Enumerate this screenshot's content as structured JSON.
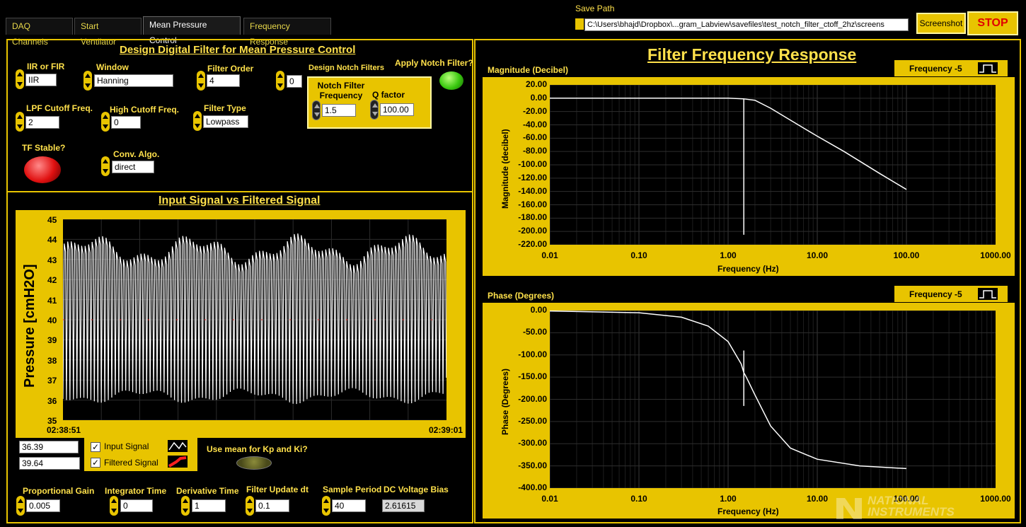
{
  "tabs": [
    {
      "label": "DAQ Channels",
      "active": false
    },
    {
      "label": "Start Ventilator",
      "active": false
    },
    {
      "label": "Mean Pressure Control",
      "active": true
    },
    {
      "label": "Frequency Response",
      "active": false
    }
  ],
  "save_path": {
    "label": "Save Path",
    "value": "C:\\Users\\bhajd\\Dropbox\\...gram_Labview\\savefiles\\test_notch_filter_ctoff_2hz\\screens"
  },
  "buttons": {
    "screenshot": "Screenshot",
    "stop": "STOP"
  },
  "design": {
    "title": "Design Digital Filter for Mean Pressure Control",
    "iir_fir": {
      "label": "IIR or FIR",
      "value": "IIR"
    },
    "window": {
      "label": "Window",
      "value": "Hanning"
    },
    "filter_order": {
      "label": "Filter Order",
      "value": "4"
    },
    "notch_count": {
      "value": "0"
    },
    "design_notch_label": "Design Notch Filters",
    "apply_notch": {
      "label": "Apply Notch Filter?",
      "on": true
    },
    "notch_freq": {
      "label": "Notch Filter Frequency",
      "value": "1.5"
    },
    "q_factor": {
      "label": "Q factor",
      "value": "100.00"
    },
    "lpf_cutoff": {
      "label": "LPF Cutoff  Freq.",
      "value": "2"
    },
    "high_cutoff": {
      "label": "High Cutoff Freq.",
      "value": "0"
    },
    "filter_type": {
      "label": "Filter Type",
      "value": "Lowpass"
    },
    "tf_stable": {
      "label": "TF Stable?",
      "on": false
    },
    "conv_algo": {
      "label": "Conv. Algo.",
      "value": "direct"
    }
  },
  "signal_chart": {
    "title": "Input Signal vs Filtered Signal",
    "ylabel": "Pressure [cmH2O]",
    "y_ticks": [
      "45",
      "44",
      "43",
      "42",
      "41",
      "40",
      "39",
      "38",
      "37",
      "36",
      "35"
    ],
    "x_start": "02:38:51",
    "x_end": "02:39:01",
    "readout_1": "36.39",
    "readout_2": "39.64",
    "legend": [
      {
        "label": "Input Signal",
        "checked": true,
        "color": "#ffffff"
      },
      {
        "label": "Filtered Signal",
        "checked": true,
        "color": "#ff2020"
      }
    ],
    "use_mean_label": "Use mean for Kp and Ki?"
  },
  "chart_data": [
    {
      "type": "line",
      "title": "Input Signal vs Filtered Signal",
      "ylabel": "Pressure [cmH2O]",
      "xlabel": "",
      "x_range": [
        "02:38:51",
        "02:39:01"
      ],
      "ylim": [
        35,
        45
      ],
      "grid": true,
      "series": [
        {
          "name": "Input Signal",
          "color": "#ffffff",
          "min": 35.9,
          "max": 44.0,
          "approx_cycles": 110
        },
        {
          "name": "Filtered Signal",
          "color": "#ff2020",
          "mean": 40.0
        }
      ]
    },
    {
      "type": "line",
      "title": "Magnitude (Decibel)",
      "xlabel": "Frequency (Hz)",
      "ylabel": "Magnitude (decibel)",
      "xscale": "log",
      "xlim": [
        0.01,
        1000
      ],
      "ylim": [
        -220,
        20
      ],
      "grid": true,
      "x": [
        0.01,
        0.1,
        1.0,
        1.5,
        1.5,
        1.5,
        2.0,
        3.0,
        5.0,
        10.0,
        20.0,
        50.0,
        100.0
      ],
      "y": [
        0,
        0,
        0,
        -1,
        -205,
        -1,
        -3,
        -15,
        -33,
        -57,
        -80,
        -113,
        -137
      ]
    },
    {
      "type": "line",
      "title": "Phase (Degrees)",
      "xlabel": "Frequency (Hz)",
      "ylabel": "Phase (Degrees)",
      "xscale": "log",
      "xlim": [
        0.01,
        1000
      ],
      "ylim": [
        -400,
        0
      ],
      "grid": true,
      "x": [
        0.01,
        0.1,
        0.3,
        0.6,
        1.0,
        1.4,
        1.5,
        1.5,
        1.5,
        1.5,
        1.6,
        2.0,
        3.0,
        5.0,
        10.0,
        30.0,
        100.0
      ],
      "y": [
        -1,
        -5,
        -15,
        -35,
        -70,
        -120,
        -140,
        -90,
        -215,
        -140,
        -150,
        -190,
        -260,
        -310,
        -335,
        -350,
        -356
      ]
    }
  ],
  "freq_response": {
    "title": "Filter Frequency Response",
    "magnitude": {
      "title": "Magnitude (Decibel)",
      "legend": "Frequency -5",
      "ylabel": "Magnitude (decibel)",
      "xlabel": "Frequency (Hz)",
      "y_ticks": [
        "20.00",
        "0.00",
        "-20.00",
        "-40.00",
        "-60.00",
        "-80.00",
        "-100.00",
        "-120.00",
        "-140.00",
        "-160.00",
        "-180.00",
        "-200.00",
        "-220.00"
      ],
      "x_ticks": [
        "0.01",
        "0.10",
        "1.00",
        "10.00",
        "100.00",
        "1000.00"
      ]
    },
    "phase": {
      "title": "Phase (Degrees)",
      "legend": "Frequency -5",
      "ylabel": "Phase (Degrees)",
      "xlabel": "Frequency (Hz)",
      "y_ticks": [
        "0.00",
        "-50.00",
        "-100.00",
        "-150.00",
        "-200.00",
        "-250.00",
        "-300.00",
        "-350.00",
        "-400.00"
      ],
      "x_ticks": [
        "0.01",
        "0.10",
        "1.00",
        "10.00",
        "100.00",
        "1000.00"
      ]
    }
  },
  "controls": [
    {
      "label": "Proportional Gain",
      "value": "0.005",
      "indicator": false
    },
    {
      "label": "Integrator Time",
      "value": "0",
      "indicator": false
    },
    {
      "label": "Derivative Time",
      "value": "1",
      "indicator": false
    },
    {
      "label": "Filter Update dt",
      "value": "0.1",
      "indicator": false
    },
    {
      "label": "Sample Period",
      "value": "40",
      "indicator": false
    },
    {
      "label": "DC Voltage Bias",
      "value": "2.61615",
      "indicator": true
    }
  ],
  "logo": {
    "line1": "NATIONAL",
    "line2": "INSTRUMENTS"
  }
}
